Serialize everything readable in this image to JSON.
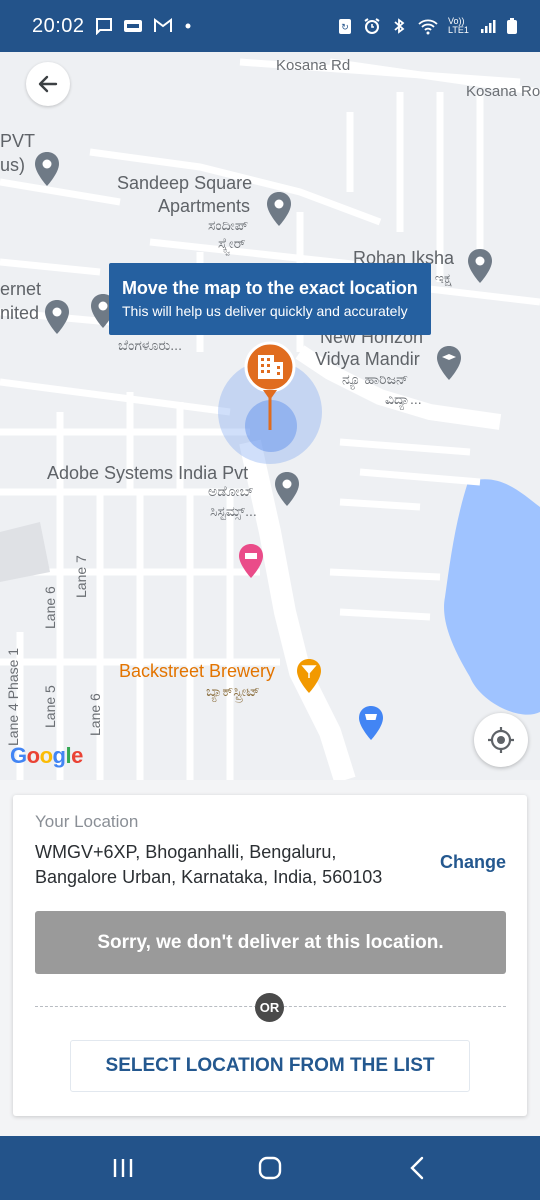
{
  "status_bar": {
    "time": "20:02",
    "left_icons": [
      "message-icon",
      "paytm-icon",
      "gmail-icon",
      "dot-icon"
    ],
    "right_icons": [
      "data-saver-icon",
      "alarm-icon",
      "bluetooth-icon",
      "wifi-icon",
      "volte-icon",
      "signal-icon",
      "battery-icon"
    ],
    "volte_label": "Vo)) LTE1"
  },
  "map": {
    "labels": {
      "kosana_rd_1": "Kosana Rd",
      "kosana_rd_2": "Kosana Ro",
      "pvt": "PVT",
      "us": "us)",
      "sandeep_square": "Sandeep Square",
      "apartments": "Apartments",
      "sandeep_kn_1": "ಸಂದೀಪ್",
      "sandeep_kn_2": "ಸ್ಕ್ವೇರ್",
      "rohan_iksha": "Rohan Iksha",
      "rohan_kn": "ಕ್ ಇಕ್ಷ",
      "ernet": "ernet",
      "nited": "nited",
      "bengaluru_kn": "ಬೆಂಗಳೂರು...",
      "new_horizon": "New Horizon",
      "vidya_mandir": "Vidya Mandir",
      "new_horizon_kn": "ನ್ಯೂ ಹಾರಿಜನ್",
      "vidya_kn": "ವಿದ್ಯಾ...",
      "adobe": "Adobe Systems India Pvt",
      "adobe_kn_1": "ಅಡೋಬ್",
      "adobe_kn_2": "ಸಿಸ್ಟಮ್ಸ್...",
      "lane_7": "Lane 7",
      "lane_6a": "Lane 6",
      "lane_6b": "Lane 6",
      "lane_5": "Lane 5",
      "lane_4": "Lane 4 Phase 1",
      "backstreet": "Backstreet Brewery",
      "backstreet_kn": "ಬ್ಯಾಕ್‌ಸ್ಟ್ರೀಟ್"
    },
    "tooltip": {
      "title": "Move the map to the exact location",
      "subtitle": "This will help us deliver quickly and accurately"
    },
    "google_logo": {
      "g": "G",
      "o1": "o",
      "o2": "o",
      "g2": "g",
      "l": "l",
      "e": "e"
    }
  },
  "location": {
    "caption": "Your Location",
    "address": "WMGV+6XP, Bhoganhalli, Bengaluru, Bangalore Urban, Karnataka, India, 560103",
    "change_label": "Change"
  },
  "no_delivery_message": "Sorry, we don't deliver at this location.",
  "or_label": "OR",
  "select_list_label": "SELECT LOCATION FROM THE LIST",
  "colors": {
    "brand_blue": "#23538a",
    "tooltip_blue": "#2560a0",
    "pin_orange": "#e06c1f",
    "disabled_gray": "#9a9a9a"
  }
}
